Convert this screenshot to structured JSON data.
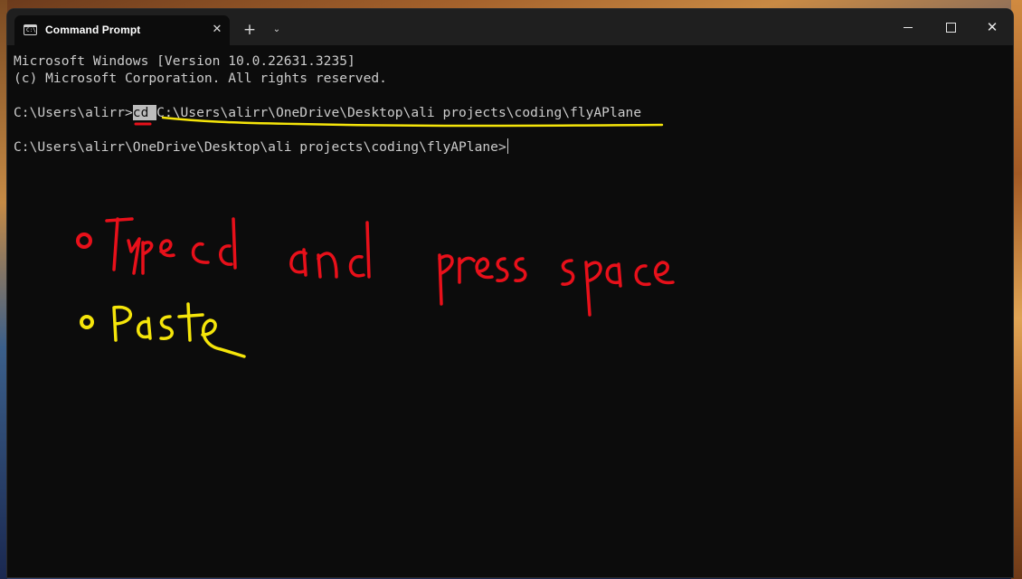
{
  "window": {
    "tab_title": "Command Prompt",
    "tab_icon": "cmd-icon",
    "controls": {
      "close_tab": "✕",
      "new_tab": "+",
      "tab_menu": "⌄",
      "window_close": "✕"
    }
  },
  "console": {
    "lines": [
      "Microsoft Windows [Version 10.0.22631.3235]",
      "(c) Microsoft Corporation. All rights reserved."
    ],
    "prompt_1": "C:\\Users\\alirr>",
    "command_highlight": "cd ",
    "command_path": "C:\\Users\\alirr\\OneDrive\\Desktop\\ali projects\\coding\\flyAPlane",
    "prompt_2": "C:\\Users\\alirr\\OneDrive\\Desktop\\ali projects\\coding\\flyAPlane>"
  },
  "annotations": {
    "note_1": "Type cd and press space",
    "note_2": "Paste",
    "colors": {
      "red": "#e8101a",
      "yellow": "#f5e50a"
    }
  },
  "colors": {
    "console_bg": "#0c0c0c",
    "titlebar_bg": "#1f1f1f",
    "text": "#cccccc"
  }
}
